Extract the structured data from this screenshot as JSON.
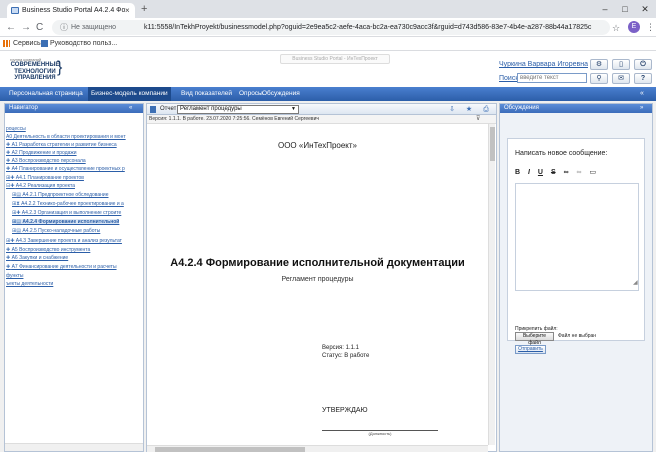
{
  "browser": {
    "tab_title": "Business Studio Portal A4.2.4 Фо",
    "tab_close": "×",
    "new_tab": "+",
    "window_controls": {
      "minimize": "–",
      "maximize": "□",
      "close": "✕"
    },
    "nav": {
      "back": "←",
      "forward": "→",
      "reload": "C"
    },
    "security_status": "Не защищено",
    "url": "k11:5558/InTekhProyekt/businessmodel.php?oguid=2e9ea5c2-aefe-4aca-bc2a-ea730c9acc3f&rguid=d743d586-83e7-4b4e-a287-88b44a17825c",
    "star": "☆",
    "profile_initial": "E",
    "menu": "⋮",
    "bookmarks": [
      {
        "label": "Сервисы"
      },
      {
        "label": "Руководство польз..."
      }
    ]
  },
  "header": {
    "logo_caption": "группа компаний",
    "logo_lines": [
      "СОВРЕМЕННЫЕ",
      "ТЕХНОЛОГИИ",
      "УПРАВЛЕНИЯ"
    ],
    "portal_title": "Business Studio Portal - ИнТехПроект",
    "user_name": "Чуркина Варвара Игоревна",
    "search_label": "Поиск",
    "search_placeholder": "введите текст"
  },
  "mainnav": {
    "items": [
      {
        "label": "Персональная страница",
        "active": false
      },
      {
        "label": "Бизнес-модель компании",
        "active": true
      },
      {
        "label": "Вид показателей",
        "active": false
      },
      {
        "label": "Опросы",
        "active": false
      },
      {
        "label": "Обсуждения",
        "active": false
      }
    ],
    "right": "«"
  },
  "navigator": {
    "title": "Навигатор",
    "collapse": "«",
    "items": [
      {
        "text": "роцессы",
        "icon": ""
      },
      {
        "text": "А0 Деятельность в области проектирования и монт",
        "icon": ""
      },
      {
        "text": "А1 Разработка стратегии и развитие бизнеса",
        "icon": "✚"
      },
      {
        "text": "А2 Продвижение и продажи",
        "icon": "✚"
      },
      {
        "text": "А3 Воспроизводство персонала",
        "icon": "✚"
      },
      {
        "text": "А4 Планирование и осуществление проектных р",
        "icon": "✚"
      },
      {
        "text": "А4.1 Планирование проектов",
        "icon": "⊞✚"
      },
      {
        "text": "А4.2 Реализация проекта",
        "icon": "⊟✚"
      },
      {
        "text": "А4.2.1 Предпроектное обследование",
        "icon": "⊞▤"
      },
      {
        "text": "А4.2.2 Технико-рабочее проектирование и а",
        "icon": "⊞⧗"
      },
      {
        "text": "А4.2.3 Организация и выполнение строите",
        "icon": "⊞✚"
      },
      {
        "text": "А4.2.4 Формирование исполнительной",
        "icon": "⊞▤"
      },
      {
        "text": "А4.2.5 Пуско-наладочные работы",
        "icon": "⊞▤"
      },
      {
        "text": "А4.3 Завершение проекта и анализ результат",
        "icon": "⊞✚"
      },
      {
        "text": "А5 Воспроизводство инструмента",
        "icon": "✚"
      },
      {
        "text": "А6 Закупки и снабжение",
        "icon": "✚"
      },
      {
        "text": "А7 Финансирование деятельности и расчеты",
        "icon": "✚"
      },
      {
        "text": "функты",
        "icon": ""
      },
      {
        "text": "ъекты деятельности",
        "icon": ""
      }
    ]
  },
  "document": {
    "report_label": "Отчет",
    "report_value": "Регламент процедуры",
    "version_info": "Версия: 1.1.1. В работе. 23.07.2020 7:25:56. Семёнов Евгений Сергеевич",
    "company": "ООО «ИнТехПроект»",
    "title": "А4.2.4 Формирование исполнительной документации",
    "subtitle": "Регламент процедуры",
    "version": "Версия: 1.1.1",
    "status": "Статус: В работе",
    "approve": "УТВЕРЖДАЮ",
    "position": "(Должность)"
  },
  "discussion": {
    "title": "Обсуждения",
    "collapse": "»",
    "new_message": "Написать новое сообщение:",
    "attach_label": "Прикрепить файл:",
    "choose_file": "Выберите файл",
    "no_file": "Файл не выбран",
    "send": "Отправить"
  },
  "colors": {
    "accent": "#2c5ea9",
    "link": "#2b5ea8"
  }
}
